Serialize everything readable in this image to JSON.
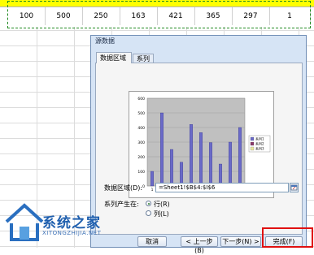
{
  "sheet": {
    "row_values": [
      "100",
      "500",
      "250",
      "163",
      "421",
      "365",
      "297",
      "1"
    ]
  },
  "dialog": {
    "title": "源数据",
    "tabs": [
      "数据区域",
      "系列"
    ],
    "range_label": "数据区域(D):",
    "range_value": "=Sheet1!$B$4:$I$6",
    "series_in_label": "系列产生在:",
    "option_row": "行(R)",
    "option_col": "列(L)",
    "buttons": {
      "cancel": "取消",
      "back": "< 上一步(B)",
      "next": "下一步(N) >",
      "finish": "完成(F)"
    }
  },
  "chart_data": {
    "type": "bar",
    "categories": [
      "1",
      "2",
      "3",
      "4",
      "5",
      "6",
      "7",
      "8",
      "9",
      "10"
    ],
    "series": [
      {
        "name": "系列1",
        "values": [
          100,
          500,
          250,
          163,
          421,
          365,
          297,
          150,
          300,
          400
        ]
      }
    ],
    "legend": [
      "系列1",
      "系列2",
      "系列3"
    ],
    "legend_position": "right",
    "ylim": [
      0,
      600
    ],
    "yticks": [
      "600",
      "500",
      "400",
      "300",
      "200",
      "100",
      "0"
    ],
    "grid": true,
    "colors": {
      "bar": "#6a6ac8",
      "plot_bg": "#c0c0c0"
    }
  },
  "watermark": {
    "title": "系统之家",
    "subtitle": "XITONGZHIJIA.NET"
  }
}
